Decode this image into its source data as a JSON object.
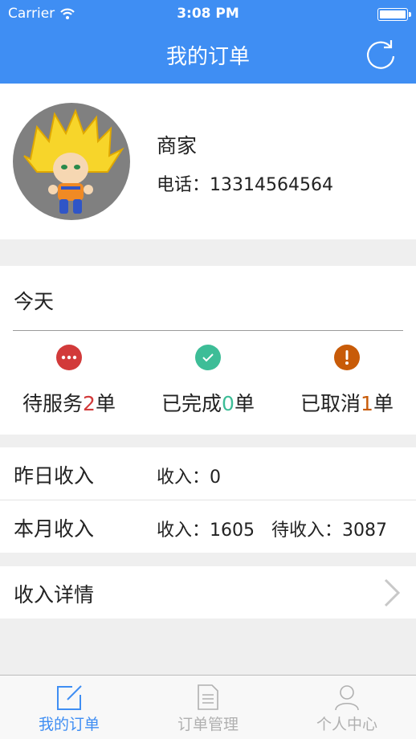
{
  "status_bar": {
    "carrier": "Carrier",
    "time": "3:08 PM"
  },
  "nav": {
    "title": "我的订单",
    "refresh_icon": "refresh-icon"
  },
  "profile": {
    "name": "商家",
    "phone": "电话：13314564564"
  },
  "today": {
    "label": "今天",
    "stats": [
      {
        "prefix": "待服务",
        "count": "2",
        "suffix": "单",
        "icon": "more-dots-icon",
        "color": "#d23a3a"
      },
      {
        "prefix": "已完成",
        "count": "0",
        "suffix": "单",
        "icon": "check-icon",
        "color": "#3dbd97"
      },
      {
        "prefix": "已取消",
        "count": "1",
        "suffix": "单",
        "icon": "exclamation-icon",
        "color": "#c85b08"
      }
    ]
  },
  "income": {
    "yesterday": {
      "label": "昨日收入",
      "value": "收入：0"
    },
    "month": {
      "label": "本月收入",
      "value": "收入：1605   待收入：3087"
    },
    "details": {
      "label": "收入详情"
    }
  },
  "tabs": [
    {
      "label": "我的订单",
      "icon": "edit-icon",
      "active": true
    },
    {
      "label": "订单管理",
      "icon": "document-icon",
      "active": false
    },
    {
      "label": "个人中心",
      "icon": "person-icon",
      "active": false
    }
  ],
  "colors": {
    "accent": "#3f8ef3",
    "background": "#efefef"
  }
}
